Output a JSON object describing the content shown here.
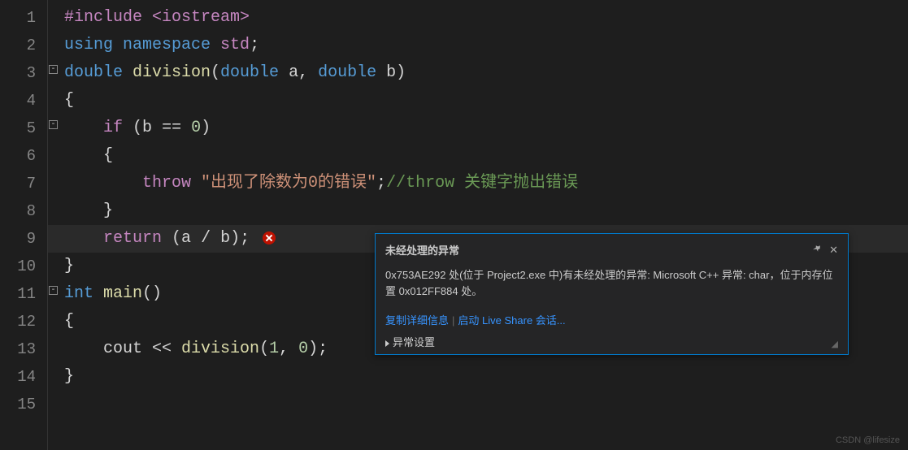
{
  "lineNumbers": [
    "1",
    "2",
    "3",
    "4",
    "5",
    "6",
    "7",
    "8",
    "9",
    "10",
    "11",
    "12",
    "13",
    "14",
    "15"
  ],
  "code": {
    "l1": {
      "include": "#include ",
      "hdr": "<iostream>"
    },
    "l2": {
      "kw1": "using ",
      "kw2": "namespace ",
      "id": "std",
      "sc": ";"
    },
    "l3": {
      "t1": "double ",
      "fn": "division",
      "p1": "(",
      "t2": "double ",
      "a": "a",
      "c": ", ",
      "t3": "double ",
      "b": "b",
      "p2": ")"
    },
    "l4": "{",
    "l5": {
      "pre": "    ",
      "kw": "if ",
      "p1": "(",
      "id": "b ",
      "op": "== ",
      "n": "0",
      "p2": ")"
    },
    "l6": "    {",
    "l7": {
      "pre": "        ",
      "kw": "throw ",
      "str": "\"出现了除数为0的错误\"",
      "sc": ";",
      "cmt": "//throw 关键字抛出错误"
    },
    "l8": "    }",
    "l9": {
      "pre": "    ",
      "kw": "return ",
      "p1": "(",
      "a": "a ",
      "op": "/ ",
      "b": "b",
      "p2": ");"
    },
    "l10": "}",
    "l11": {
      "t": "int ",
      "fn": "main",
      "p": "()"
    },
    "l12": "{",
    "l13": {
      "pre": "    ",
      "id": "cout ",
      "op": "<< ",
      "fn": "division",
      "p1": "(",
      "n1": "1",
      "c": ", ",
      "n2": "0",
      "p2": ");"
    },
    "l14": "}"
  },
  "exception": {
    "title": "未经处理的异常",
    "body": "0x753AE292 处(位于 Project2.exe 中)有未经处理的异常: Microsoft C++ 异常: char，位于内存位置 0x012FF884 处。",
    "copyLink": "复制详细信息",
    "liveShareLink": "启动 Live Share 会话...",
    "settingsLabel": "异常设置"
  },
  "watermark": "CSDN @lifesize"
}
